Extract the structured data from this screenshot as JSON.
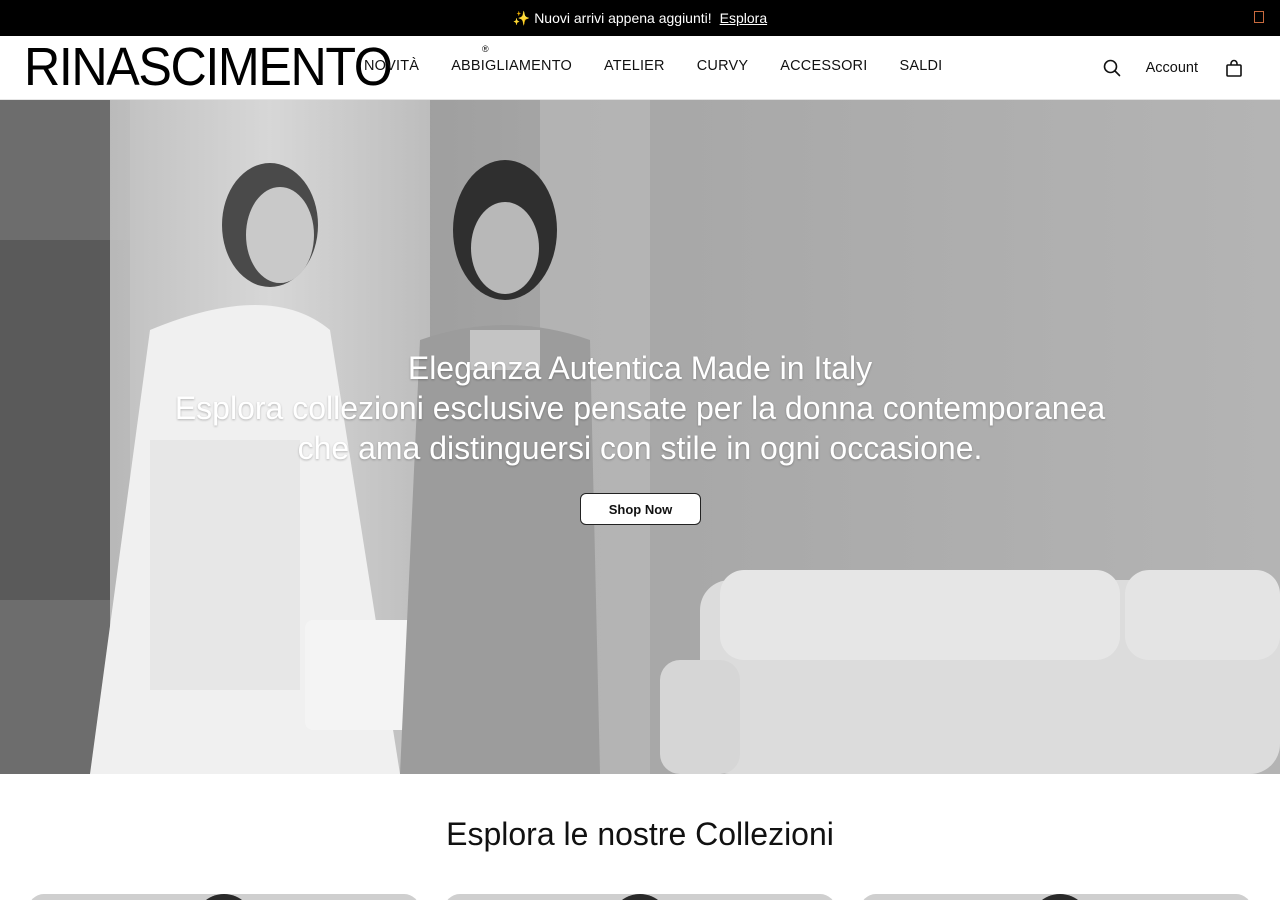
{
  "announcement": {
    "message": "✨ Nuovi arrivi appena aggiunti!",
    "link_label": "Esplora"
  },
  "header": {
    "logo_text": "RINASCIMENTO",
    "logo_mark": "®",
    "nav": [
      {
        "label": "NOVITÀ"
      },
      {
        "label": "ABBIGLIAMENTO"
      },
      {
        "label": "ATELIER"
      },
      {
        "label": "CURVY"
      },
      {
        "label": "ACCESSORI"
      },
      {
        "label": "SALDI"
      }
    ],
    "account_label": "Account",
    "icons": {
      "search": "search-icon",
      "cart": "shopping-bag-icon"
    }
  },
  "hero": {
    "title": "Eleganza Autentica Made in Italy",
    "subtitle_line1": "Esplora collezioni esclusive pensate per la donna contemporanea",
    "subtitle_line2": "che ama distinguersi con stile in ogni occasione.",
    "cta_label": "Shop Now"
  },
  "collections": {
    "title": "Esplora le nostre Collezioni"
  }
}
